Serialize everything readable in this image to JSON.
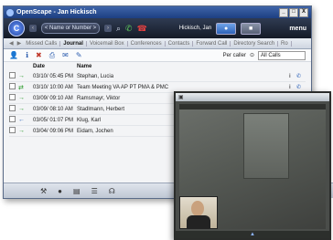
{
  "window": {
    "title": "OpenScape - Jan Hickisch",
    "controls": {
      "minimize": "_",
      "maximize": "□",
      "close": "X"
    }
  },
  "toolbar": {
    "logo_glyph": "C",
    "back_glyph": "‹",
    "forward_glyph": "›",
    "dial_placeholder": "< Name or Number >",
    "user": "Hickisch, Jan",
    "menu": "menu"
  },
  "tabs": [
    "Missed Calls",
    "Journal",
    "Voicemail Box",
    "Conferences",
    "Contacts",
    "Forward Call",
    "Directory Search",
    "Ro"
  ],
  "active_tab": "Journal",
  "filter": {
    "label": "Per caller",
    "value": "All Calls"
  },
  "table": {
    "columns": [
      "Date",
      "Name"
    ],
    "rows": [
      {
        "date": "03/10/ 05:45 PM",
        "name": "Stephan, Lucia",
        "dir": "→"
      },
      {
        "date": "03/10/ 10:00 AM",
        "name": "Team Meeting VA AP PT PMA & PMC",
        "dir": "⇄"
      },
      {
        "date": "03/09/ 09:10 AM",
        "name": "Ramsmayr, Viktor",
        "dir": "→"
      },
      {
        "date": "03/09/ 08:10 AM",
        "name": "Stadlmann, Herbert",
        "dir": "→"
      },
      {
        "date": "03/05/ 01:07 PM",
        "name": "Klug, Karl",
        "dir": "←"
      },
      {
        "date": "03/04/ 09:06 PM",
        "name": "Eidam, Jochen",
        "dir": "→"
      }
    ]
  },
  "video": {
    "title": "",
    "controls_glyph": "▲"
  }
}
